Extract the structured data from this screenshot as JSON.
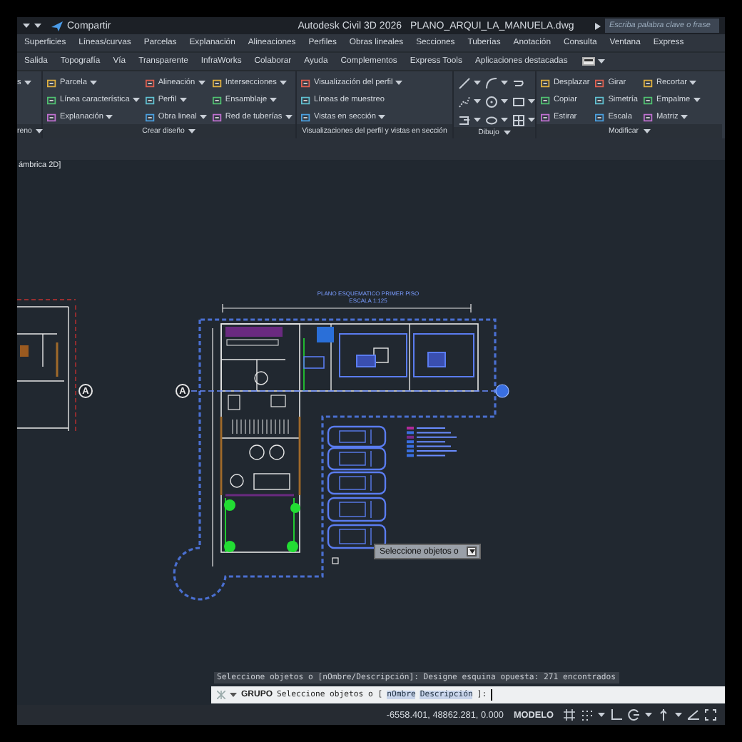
{
  "title_bar": {
    "share": "Compartir",
    "app": "Autodesk Civil 3D 2026",
    "file": "PLANO_ARQUI_LA_MANUELA.dwg",
    "search": {
      "placeholder": "Escriba palabra clave o frase"
    }
  },
  "menu_tabs": [
    {
      "label": "Superficies",
      "selected": false
    },
    {
      "label": "Líneas/curvas",
      "selected": false
    },
    {
      "label": "Parcelas",
      "selected": false
    },
    {
      "label": "Explanación",
      "selected": false
    },
    {
      "label": "Alineaciones",
      "selected": false
    },
    {
      "label": "Perfiles",
      "selected": false
    },
    {
      "label": "Obras lineales",
      "selected": false
    },
    {
      "label": "Secciones",
      "selected": false
    },
    {
      "label": "Tuberías",
      "selected": false
    },
    {
      "label": "Anotación",
      "selected": false
    },
    {
      "label": "Consulta",
      "selected": false
    },
    {
      "label": "Ventana",
      "selected": false
    },
    {
      "label": "Express",
      "selected": false
    }
  ],
  "ribbon_tabs": [
    {
      "label": "Salida",
      "selected": false
    },
    {
      "label": "Topografía",
      "selected": false
    },
    {
      "label": "Vía",
      "selected": false
    },
    {
      "label": "Transparente",
      "selected": false
    },
    {
      "label": "InfraWorks",
      "selected": false
    },
    {
      "label": "Colaborar",
      "selected": false
    },
    {
      "label": "Ayuda",
      "selected": false
    },
    {
      "label": "Complementos",
      "selected": false
    },
    {
      "label": "Express Tools",
      "selected": false
    },
    {
      "label": "Aplicaciones destacadas",
      "selected": false
    }
  ],
  "panels": [
    {
      "kind": "buttons",
      "title": "reno",
      "title_dropdown": true,
      "columns": [
        [
          {
            "label": "s",
            "dropdown": true
          }
        ]
      ]
    },
    {
      "kind": "buttons",
      "title": "Crear diseño",
      "title_dropdown": true,
      "columns": [
        [
          {
            "label": "Parcela",
            "dropdown": true
          },
          {
            "label": "Línea característica",
            "dropdown": true
          },
          {
            "label": "Explanación",
            "dropdown": true
          }
        ],
        [
          {
            "label": "Alineación",
            "dropdown": true
          },
          {
            "label": "Perfil",
            "dropdown": true
          },
          {
            "label": "Obra lineal",
            "dropdown": true
          }
        ],
        [
          {
            "label": "Intersecciones",
            "dropdown": true
          },
          {
            "label": "Ensamblaje",
            "dropdown": true
          },
          {
            "label": "Red de tuberías",
            "dropdown": true
          }
        ]
      ]
    },
    {
      "kind": "buttons",
      "title": "Visualizaciones del perfil y vistas en sección",
      "title_dropdown": false,
      "columns": [
        [
          {
            "label": "Visualización del perfil",
            "dropdown": true
          },
          {
            "label": "Líneas de muestreo",
            "dropdown": false
          },
          {
            "label": "Vistas en sección",
            "dropdown": true
          }
        ]
      ]
    },
    {
      "kind": "tools",
      "title": "Dibujo",
      "title_dropdown": true,
      "tools": [
        {
          "kind": "line",
          "dropdown": true
        },
        {
          "kind": "arc",
          "dropdown": true
        },
        {
          "kind": "curve",
          "dropdown": false
        },
        {
          "kind": "polyline",
          "dropdown": true
        },
        {
          "kind": "circle",
          "dropdown": true
        },
        {
          "kind": "rectangle",
          "dropdown": true
        },
        {
          "kind": "block",
          "dropdown": true
        },
        {
          "kind": "ellipse",
          "dropdown": true
        },
        {
          "kind": "hatch",
          "dropdown": true
        }
      ]
    },
    {
      "kind": "buttons",
      "title": "Modificar",
      "title_dropdown": true,
      "columns": [
        [
          {
            "label": "Desplazar",
            "dropdown": false
          },
          {
            "label": "Copiar",
            "dropdown": false
          },
          {
            "label": "Estirar",
            "dropdown": false
          }
        ],
        [
          {
            "label": "Girar",
            "dropdown": false
          },
          {
            "label": "Simetría",
            "dropdown": false
          },
          {
            "label": "Escala",
            "dropdown": false
          }
        ],
        [
          {
            "label": "Recortar",
            "dropdown": true
          },
          {
            "label": "Empalme",
            "dropdown": true
          },
          {
            "label": "Matriz",
            "dropdown": true
          }
        ]
      ]
    }
  ],
  "viewport": {
    "label": "ámbrica 2D]",
    "plan_title": "PLANO ESQUEMATICO PRIMER PISO",
    "plan_scale": "ESCALA 1:125",
    "section_markers": [
      {
        "label": "A"
      },
      {
        "label": "A"
      }
    ],
    "tooltip": "Seleccione objetos o"
  },
  "command": {
    "history": "Seleccione objetos o [nOmbre/Descripción]: Designe esquina opuesta: 271 encontrados",
    "name": "GRUPO",
    "prompt": "Seleccione objetos o [",
    "options": [
      "nOmbre",
      "Descripción"
    ],
    "suffix": "]:"
  },
  "status_bar": {
    "coordinates": "-6558.401, 48862.281, 0.000",
    "space": "MODELO"
  }
}
